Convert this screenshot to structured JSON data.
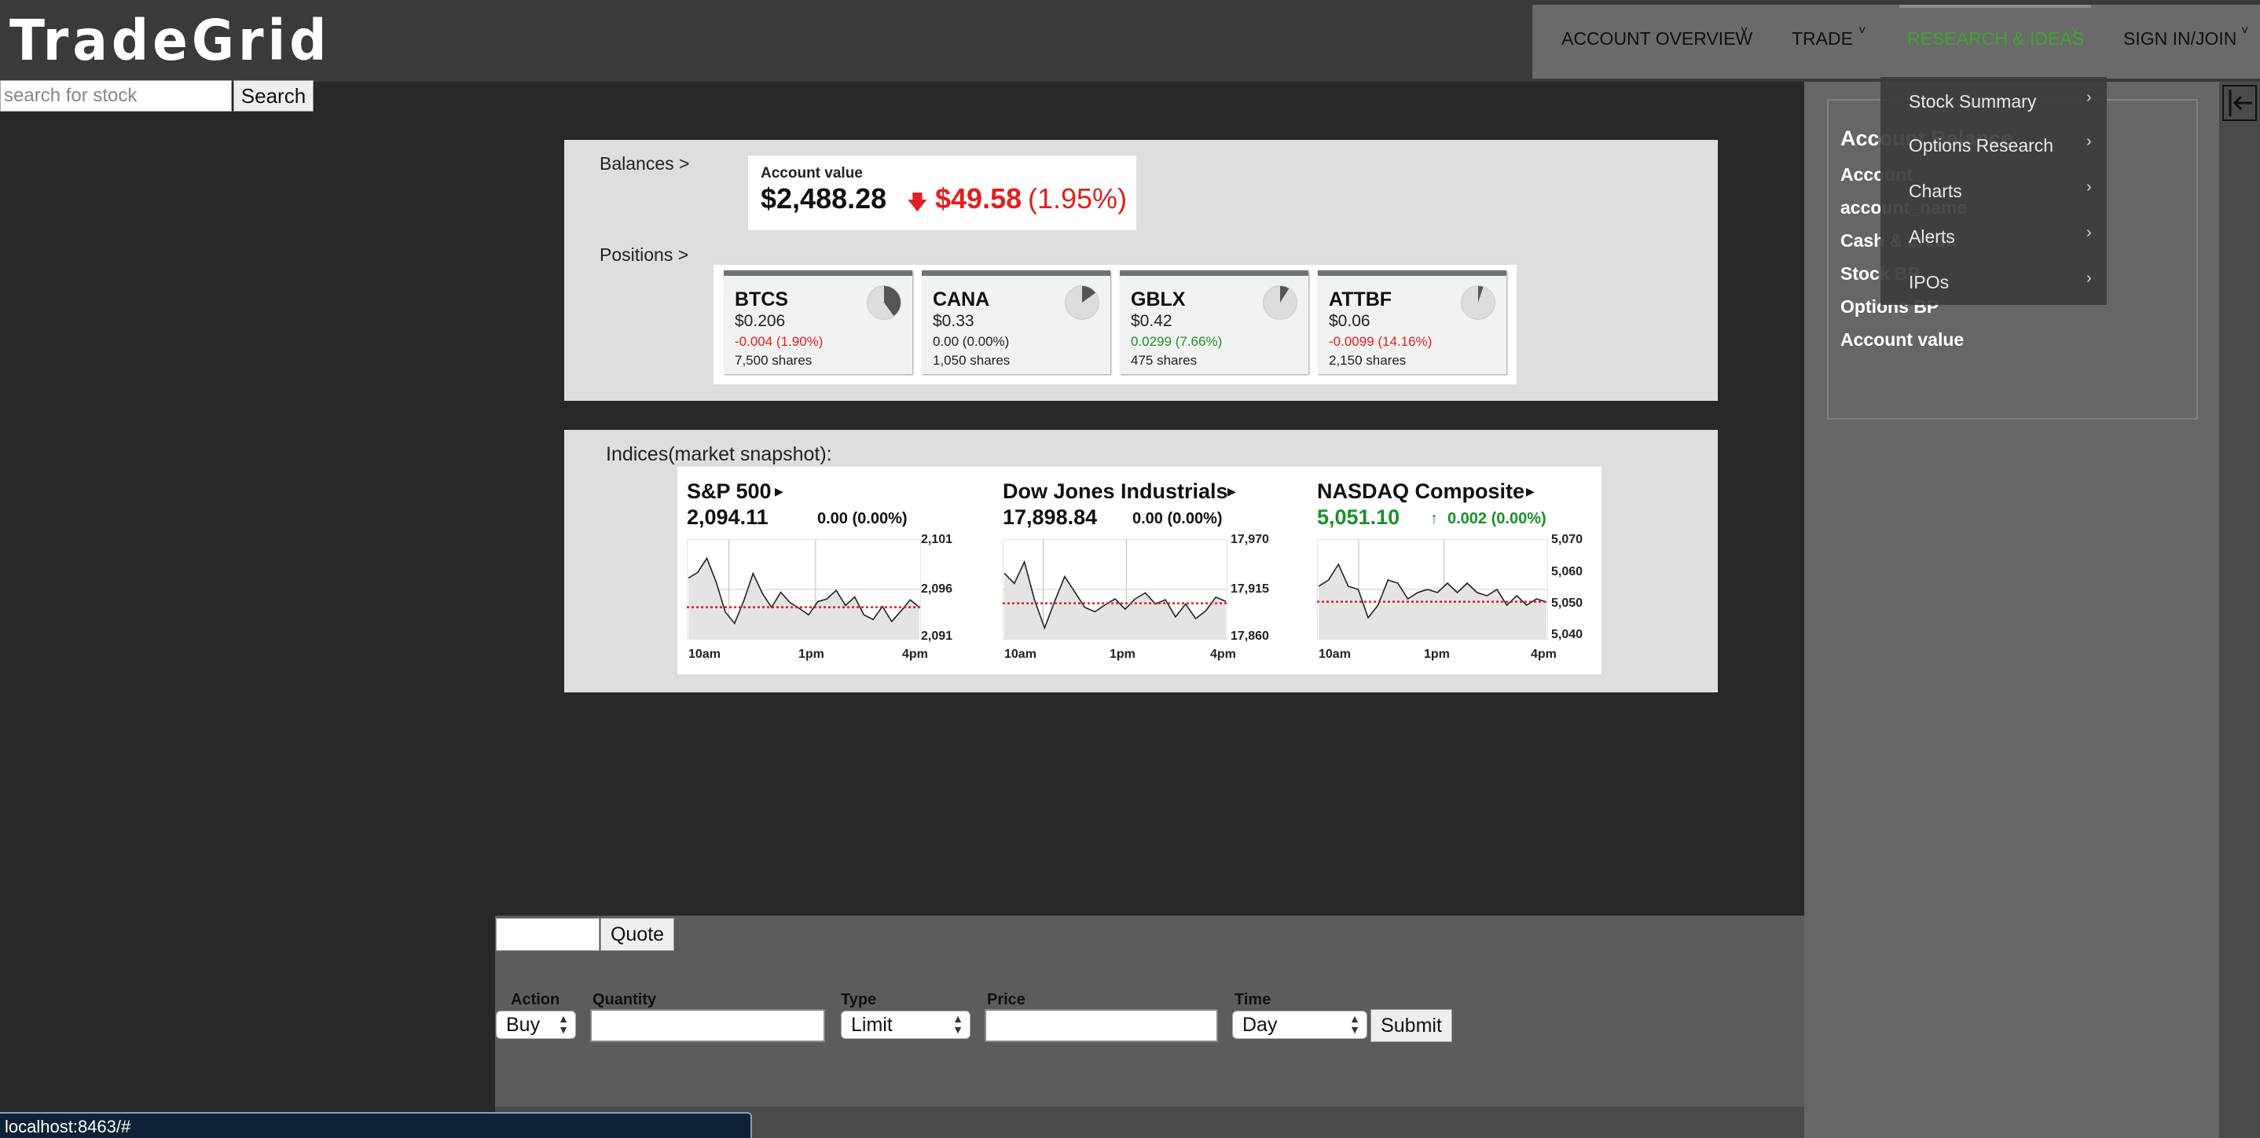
{
  "header": {
    "logo": "TradeGrid",
    "nav": [
      {
        "label": "ACCOUNT OVERVIEW",
        "active": false
      },
      {
        "label": "TRADE",
        "active": false
      },
      {
        "label": "RESEARCH & IDEAS",
        "active": true
      },
      {
        "label": "SIGN IN/JOIN",
        "active": false
      }
    ]
  },
  "search": {
    "placeholder": "search for stock",
    "button": "Search"
  },
  "dropdown": {
    "items": [
      "Stock Summary",
      "Options Research",
      "Charts",
      "Alerts",
      "IPOs"
    ]
  },
  "account_panel": {
    "lines": [
      "Account Balance",
      "Account",
      "account_name",
      "Cash & credit",
      "Stock BP",
      "Options BP",
      "Account value"
    ]
  },
  "balances": {
    "label": "Balances >",
    "card_title": "Account value",
    "value": "$2,488.28",
    "change": "$49.58",
    "change_pct": "(1.95%)",
    "direction_icon": "arrow-down-icon"
  },
  "positions": {
    "label": "Positions >",
    "items": [
      {
        "symbol": "BTCS",
        "price": "$0.206",
        "change": "-0.004 (1.90%)",
        "shares": "7,500 shares",
        "direction": "down",
        "portfolio_fraction": 0.4
      },
      {
        "symbol": "CANA",
        "price": "$0.33",
        "change": "0.00 (0.00%)",
        "shares": "1,050 shares",
        "direction": "flat",
        "portfolio_fraction": 0.15
      },
      {
        "symbol": "GBLX",
        "price": "$0.42",
        "change": "0.0299 (7.66%)",
        "shares": "475 shares",
        "direction": "up",
        "portfolio_fraction": 0.09
      },
      {
        "symbol": "ATTBF",
        "price": "$0.06",
        "change": "-0.0099 (14.16%)",
        "shares": "2,150 shares",
        "direction": "down",
        "portfolio_fraction": 0.05
      }
    ]
  },
  "indices": {
    "label": "Indices(market snapshot):",
    "items": [
      {
        "name": "S&P 500",
        "value": "2,094.11",
        "change": "0.00 (0.00%)",
        "up": false,
        "y_ticks": [
          "2,101",
          "2,096",
          "2,091"
        ],
        "x_ticks": [
          "10am",
          "1pm",
          "4pm"
        ]
      },
      {
        "name": "Dow Jones Industrials",
        "value": "17,898.84",
        "change": "0.00 (0.00%)",
        "up": false,
        "y_ticks": [
          "17,970",
          "17,915",
          "17,860"
        ],
        "x_ticks": [
          "10am",
          "1pm",
          "4pm"
        ]
      },
      {
        "name": "NASDAQ Composite",
        "value": "5,051.10",
        "change": "0.002 (0.00%)",
        "up": true,
        "y_ticks": [
          "5,070",
          "5,060",
          "5,050",
          "5,040"
        ],
        "x_ticks": [
          "10am",
          "1pm",
          "4pm"
        ]
      }
    ]
  },
  "chart_data": [
    {
      "type": "line",
      "title": "S&P 500",
      "ylim": [
        2091,
        2101
      ],
      "reference": 2094.11,
      "x": [
        "10am",
        "1pm",
        "4pm"
      ],
      "values": [
        2097.2,
        2097.8,
        2099.3,
        2096.8,
        2093.6,
        2092.4,
        2094.8,
        2097.7,
        2095.6,
        2094.1,
        2095.7,
        2094.6,
        2094.0,
        2093.3,
        2094.7,
        2095.0,
        2095.9,
        2094.3,
        2095.2,
        2093.3,
        2092.8,
        2094.2,
        2092.6,
        2093.7,
        2094.9,
        2094.1
      ]
    },
    {
      "type": "line",
      "title": "Dow Jones Industrials",
      "ylim": [
        17860,
        17970
      ],
      "reference": 17898.84,
      "x": [
        "10am",
        "1pm",
        "4pm"
      ],
      "values": [
        17934,
        17922,
        17947,
        17903,
        17870,
        17901,
        17930,
        17912,
        17894,
        17889,
        17897,
        17904,
        17892,
        17904,
        17911,
        17898,
        17903,
        17883,
        17898,
        17881,
        17890,
        17906,
        17901
      ]
    },
    {
      "type": "line",
      "title": "NASDAQ Composite",
      "ylim": [
        5040,
        5070
      ],
      "reference": 5051.1,
      "x": [
        "10am",
        "1pm",
        "4pm"
      ],
      "values": [
        5056,
        5058,
        5063,
        5056,
        5055,
        5046,
        5050,
        5058,
        5057,
        5052,
        5054,
        5055,
        5054,
        5057,
        5054,
        5057,
        5054,
        5053,
        5055,
        5050,
        5053,
        5050,
        5052,
        5051
      ]
    }
  ],
  "order": {
    "quote_button": "Quote",
    "labels": {
      "action": "Action",
      "quantity": "Quantity",
      "type": "Type",
      "price": "Price",
      "time": "Time"
    },
    "action_value": "Buy",
    "type_value": "Limit",
    "time_value": "Day",
    "submit": "Submit"
  },
  "status_bar": {
    "url": "localhost:8463/#"
  },
  "colors": {
    "accent_green": "#3ea52e",
    "down_red": "#e02020",
    "up_green": "#19902a"
  }
}
